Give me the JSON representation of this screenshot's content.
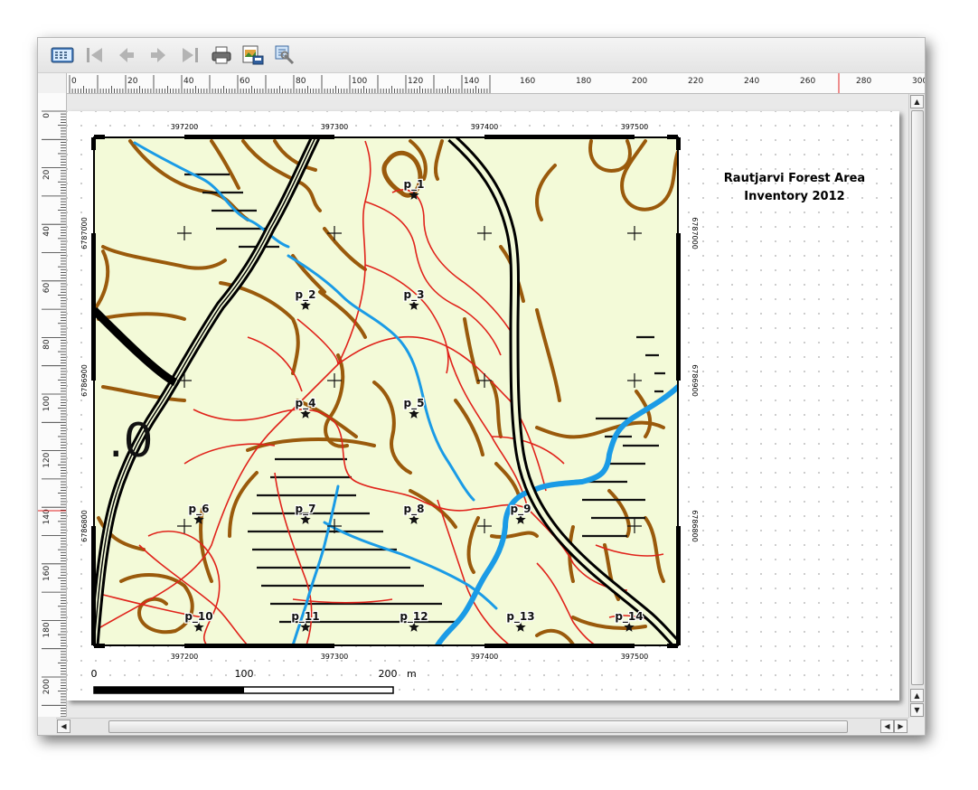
{
  "toolbar": {
    "buttons": [
      {
        "name": "atlas-preview-icon",
        "icon": "atlas-preview"
      },
      {
        "name": "first-feature-icon",
        "icon": "first-feature"
      },
      {
        "name": "previous-feature-icon",
        "icon": "previous-feature"
      },
      {
        "name": "next-feature-icon",
        "icon": "next-feature"
      },
      {
        "name": "last-feature-icon",
        "icon": "last-feature"
      },
      {
        "name": "print-atlas-icon",
        "icon": "print"
      },
      {
        "name": "export-atlas-icon",
        "icon": "export-image"
      },
      {
        "name": "atlas-settings-icon",
        "icon": "settings-wrench"
      }
    ]
  },
  "rulers": {
    "horizontal_labels": [
      "0",
      "20",
      "40",
      "60",
      "80",
      "100",
      "120",
      "140",
      "160",
      "180",
      "200",
      "220",
      "240",
      "260",
      "280",
      "300"
    ],
    "vertical_labels": [
      "0",
      "20",
      "40",
      "60",
      "80",
      "100",
      "120",
      "140",
      "160",
      "180",
      "200"
    ]
  },
  "layout": {
    "title_line1": "Rautjarvi Forest Area",
    "title_line2": "Inventory 2012",
    "map": {
      "grid_x_labels": [
        "397200",
        "397300",
        "397400",
        "397500"
      ],
      "grid_y_labels": [
        "6787000",
        "6786900",
        "6786800"
      ],
      "points": [
        "p_1",
        "p_2",
        "p_3",
        "p_4",
        "p_5",
        "p_6",
        "p_7",
        "p_8",
        "p_9",
        "p_10",
        "p_11",
        "p_12",
        "p_13",
        "p_14"
      ],
      "background_label": ".0"
    },
    "scalebar": {
      "labels": [
        "0",
        "100",
        "200"
      ],
      "unit": "m"
    }
  },
  "colors": {
    "map_background": "#f3fad8",
    "contours": "#9a5a0c",
    "roads": "#000000",
    "paths": "#e0231b",
    "streams": "#1a9be6"
  }
}
